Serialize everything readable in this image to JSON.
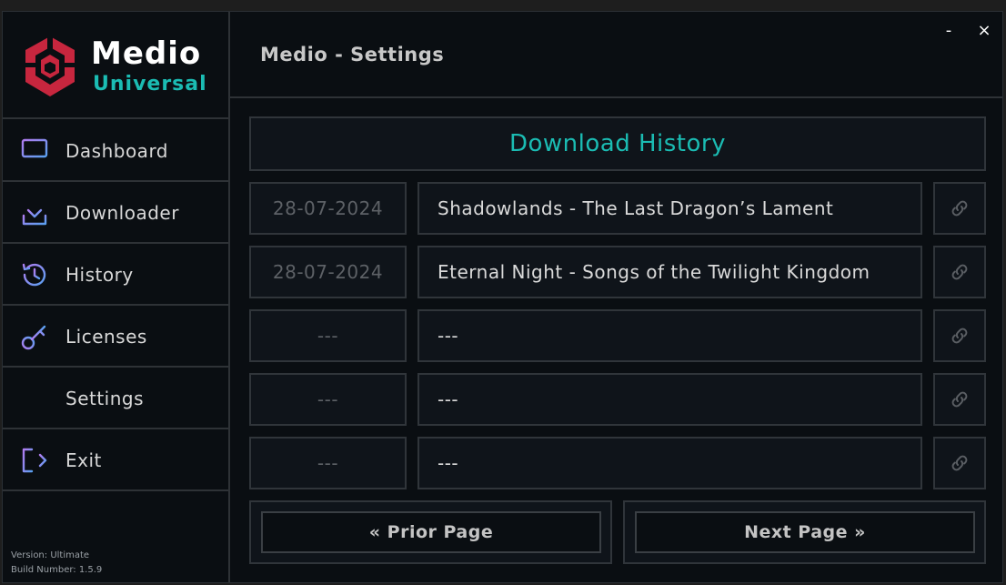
{
  "brand": {
    "name": "Medio",
    "subtitle": "Universal",
    "logo_color": "#c7263e",
    "accent_color": "#1bbcb3"
  },
  "sidebar": {
    "items": [
      {
        "label": "Dashboard",
        "icon": "monitor-icon"
      },
      {
        "label": "Downloader",
        "icon": "download-icon"
      },
      {
        "label": "History",
        "icon": "history-icon"
      },
      {
        "label": "Licenses",
        "icon": "key-icon"
      },
      {
        "label": "Settings",
        "icon": "sliders-icon"
      },
      {
        "label": "Exit",
        "icon": "exit-icon"
      }
    ],
    "version": "Version: Ultimate",
    "build": "Build Number: 1.5.9"
  },
  "header": {
    "title": "Medio - Settings",
    "minimize": "-",
    "close": "×"
  },
  "history": {
    "title": "Download History",
    "rows": [
      {
        "date": "28-07-2024",
        "title": "Shadowlands - The Last Dragon’s Lament"
      },
      {
        "date": "28-07-2024",
        "title": "Eternal Night - Songs of the Twilight Kingdom"
      },
      {
        "date": "---",
        "title": "---"
      },
      {
        "date": "---",
        "title": "---"
      },
      {
        "date": "---",
        "title": "---"
      }
    ],
    "prior_label": "« Prior Page",
    "next_label": "Next Page »"
  }
}
